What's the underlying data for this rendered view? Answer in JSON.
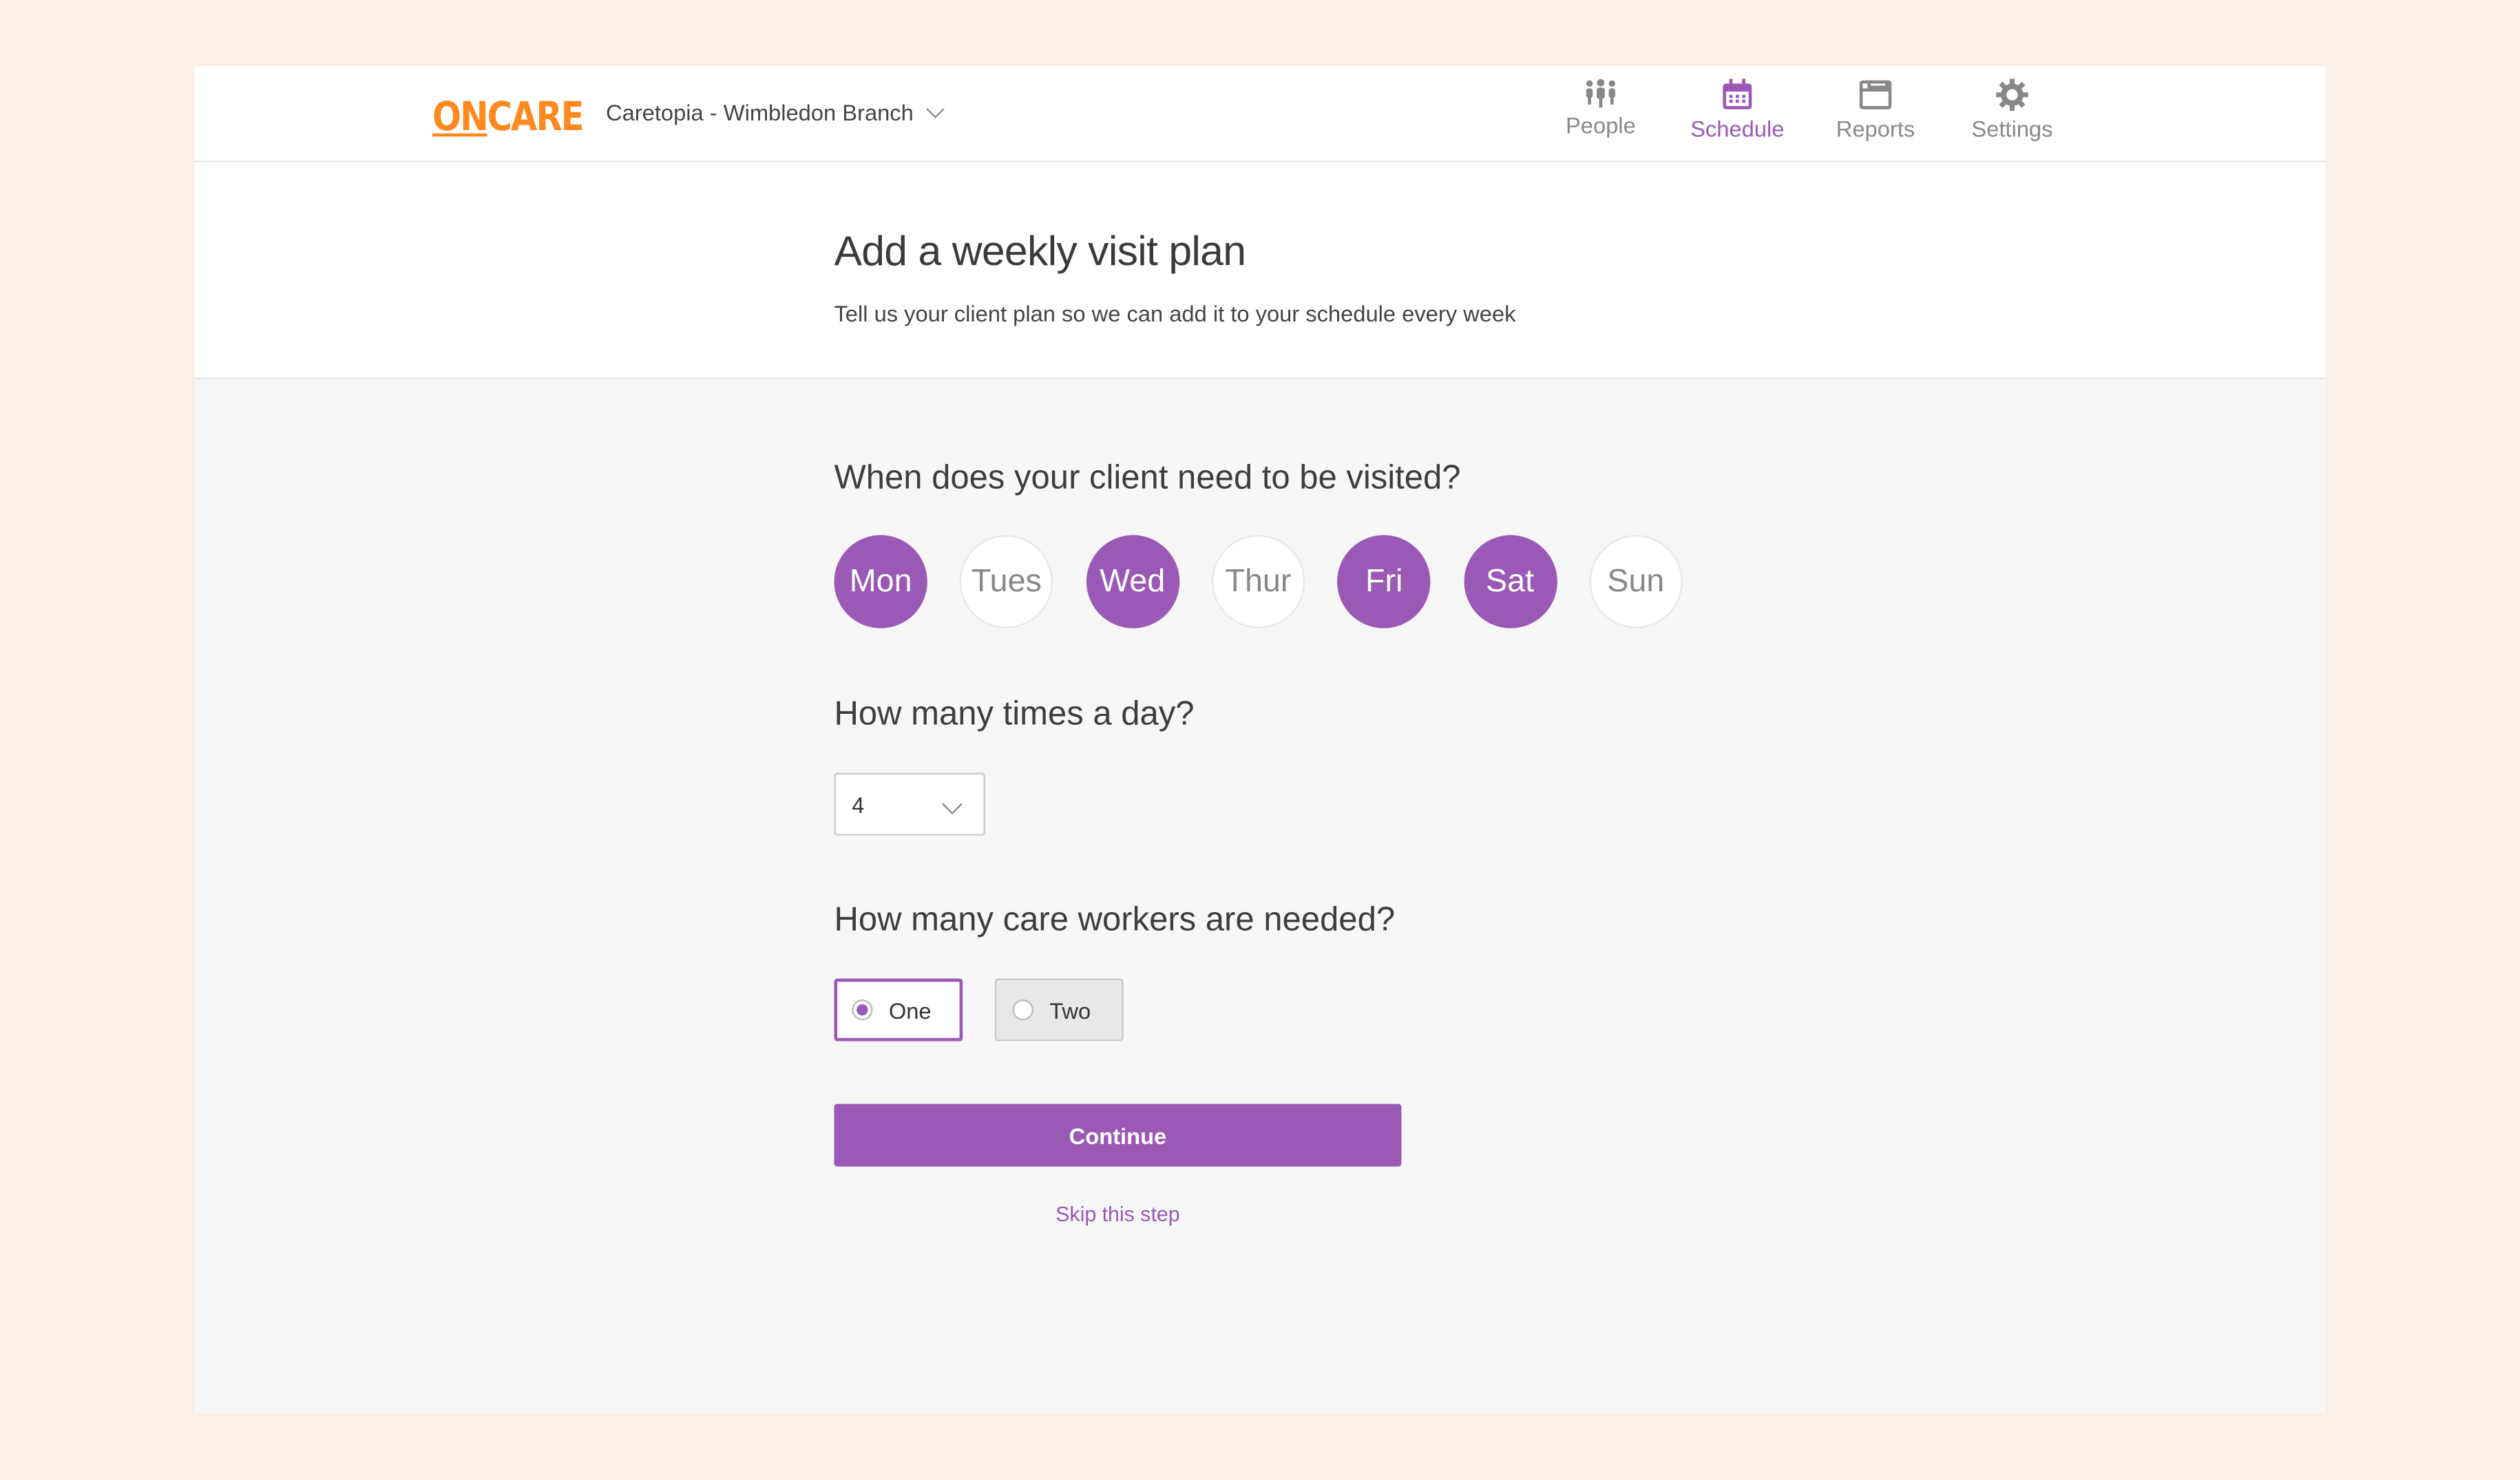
{
  "header": {
    "logo": {
      "part1": "ON",
      "part2": "CARE"
    },
    "branch": "Caretopia - Wimbledon Branch",
    "nav": [
      {
        "label": "People",
        "icon": "people-icon",
        "active": false
      },
      {
        "label": "Schedule",
        "icon": "calendar-icon",
        "active": true
      },
      {
        "label": "Reports",
        "icon": "reports-icon",
        "active": false
      },
      {
        "label": "Settings",
        "icon": "gear-icon",
        "active": false
      }
    ]
  },
  "page": {
    "title": "Add a weekly visit plan",
    "subtitle": "Tell us your client plan so we can add it to your schedule every week"
  },
  "form": {
    "days_question": "When does your client need to be visited?",
    "days": [
      {
        "label": "Mon",
        "selected": true
      },
      {
        "label": "Tues",
        "selected": false
      },
      {
        "label": "Wed",
        "selected": true
      },
      {
        "label": "Thur",
        "selected": false
      },
      {
        "label": "Fri",
        "selected": true
      },
      {
        "label": "Sat",
        "selected": true
      },
      {
        "label": "Sun",
        "selected": false
      }
    ],
    "times_question": "How many times a day?",
    "times_value": "4",
    "workers_question": "How many care workers are needed?",
    "workers_options": [
      {
        "label": "One",
        "selected": true
      },
      {
        "label": "Two",
        "selected": false
      }
    ],
    "continue_label": "Continue",
    "skip_label": "Skip this step"
  },
  "colors": {
    "accent": "#9b59b6",
    "brand": "#ff8a1f",
    "background": "#fcf2e9"
  }
}
